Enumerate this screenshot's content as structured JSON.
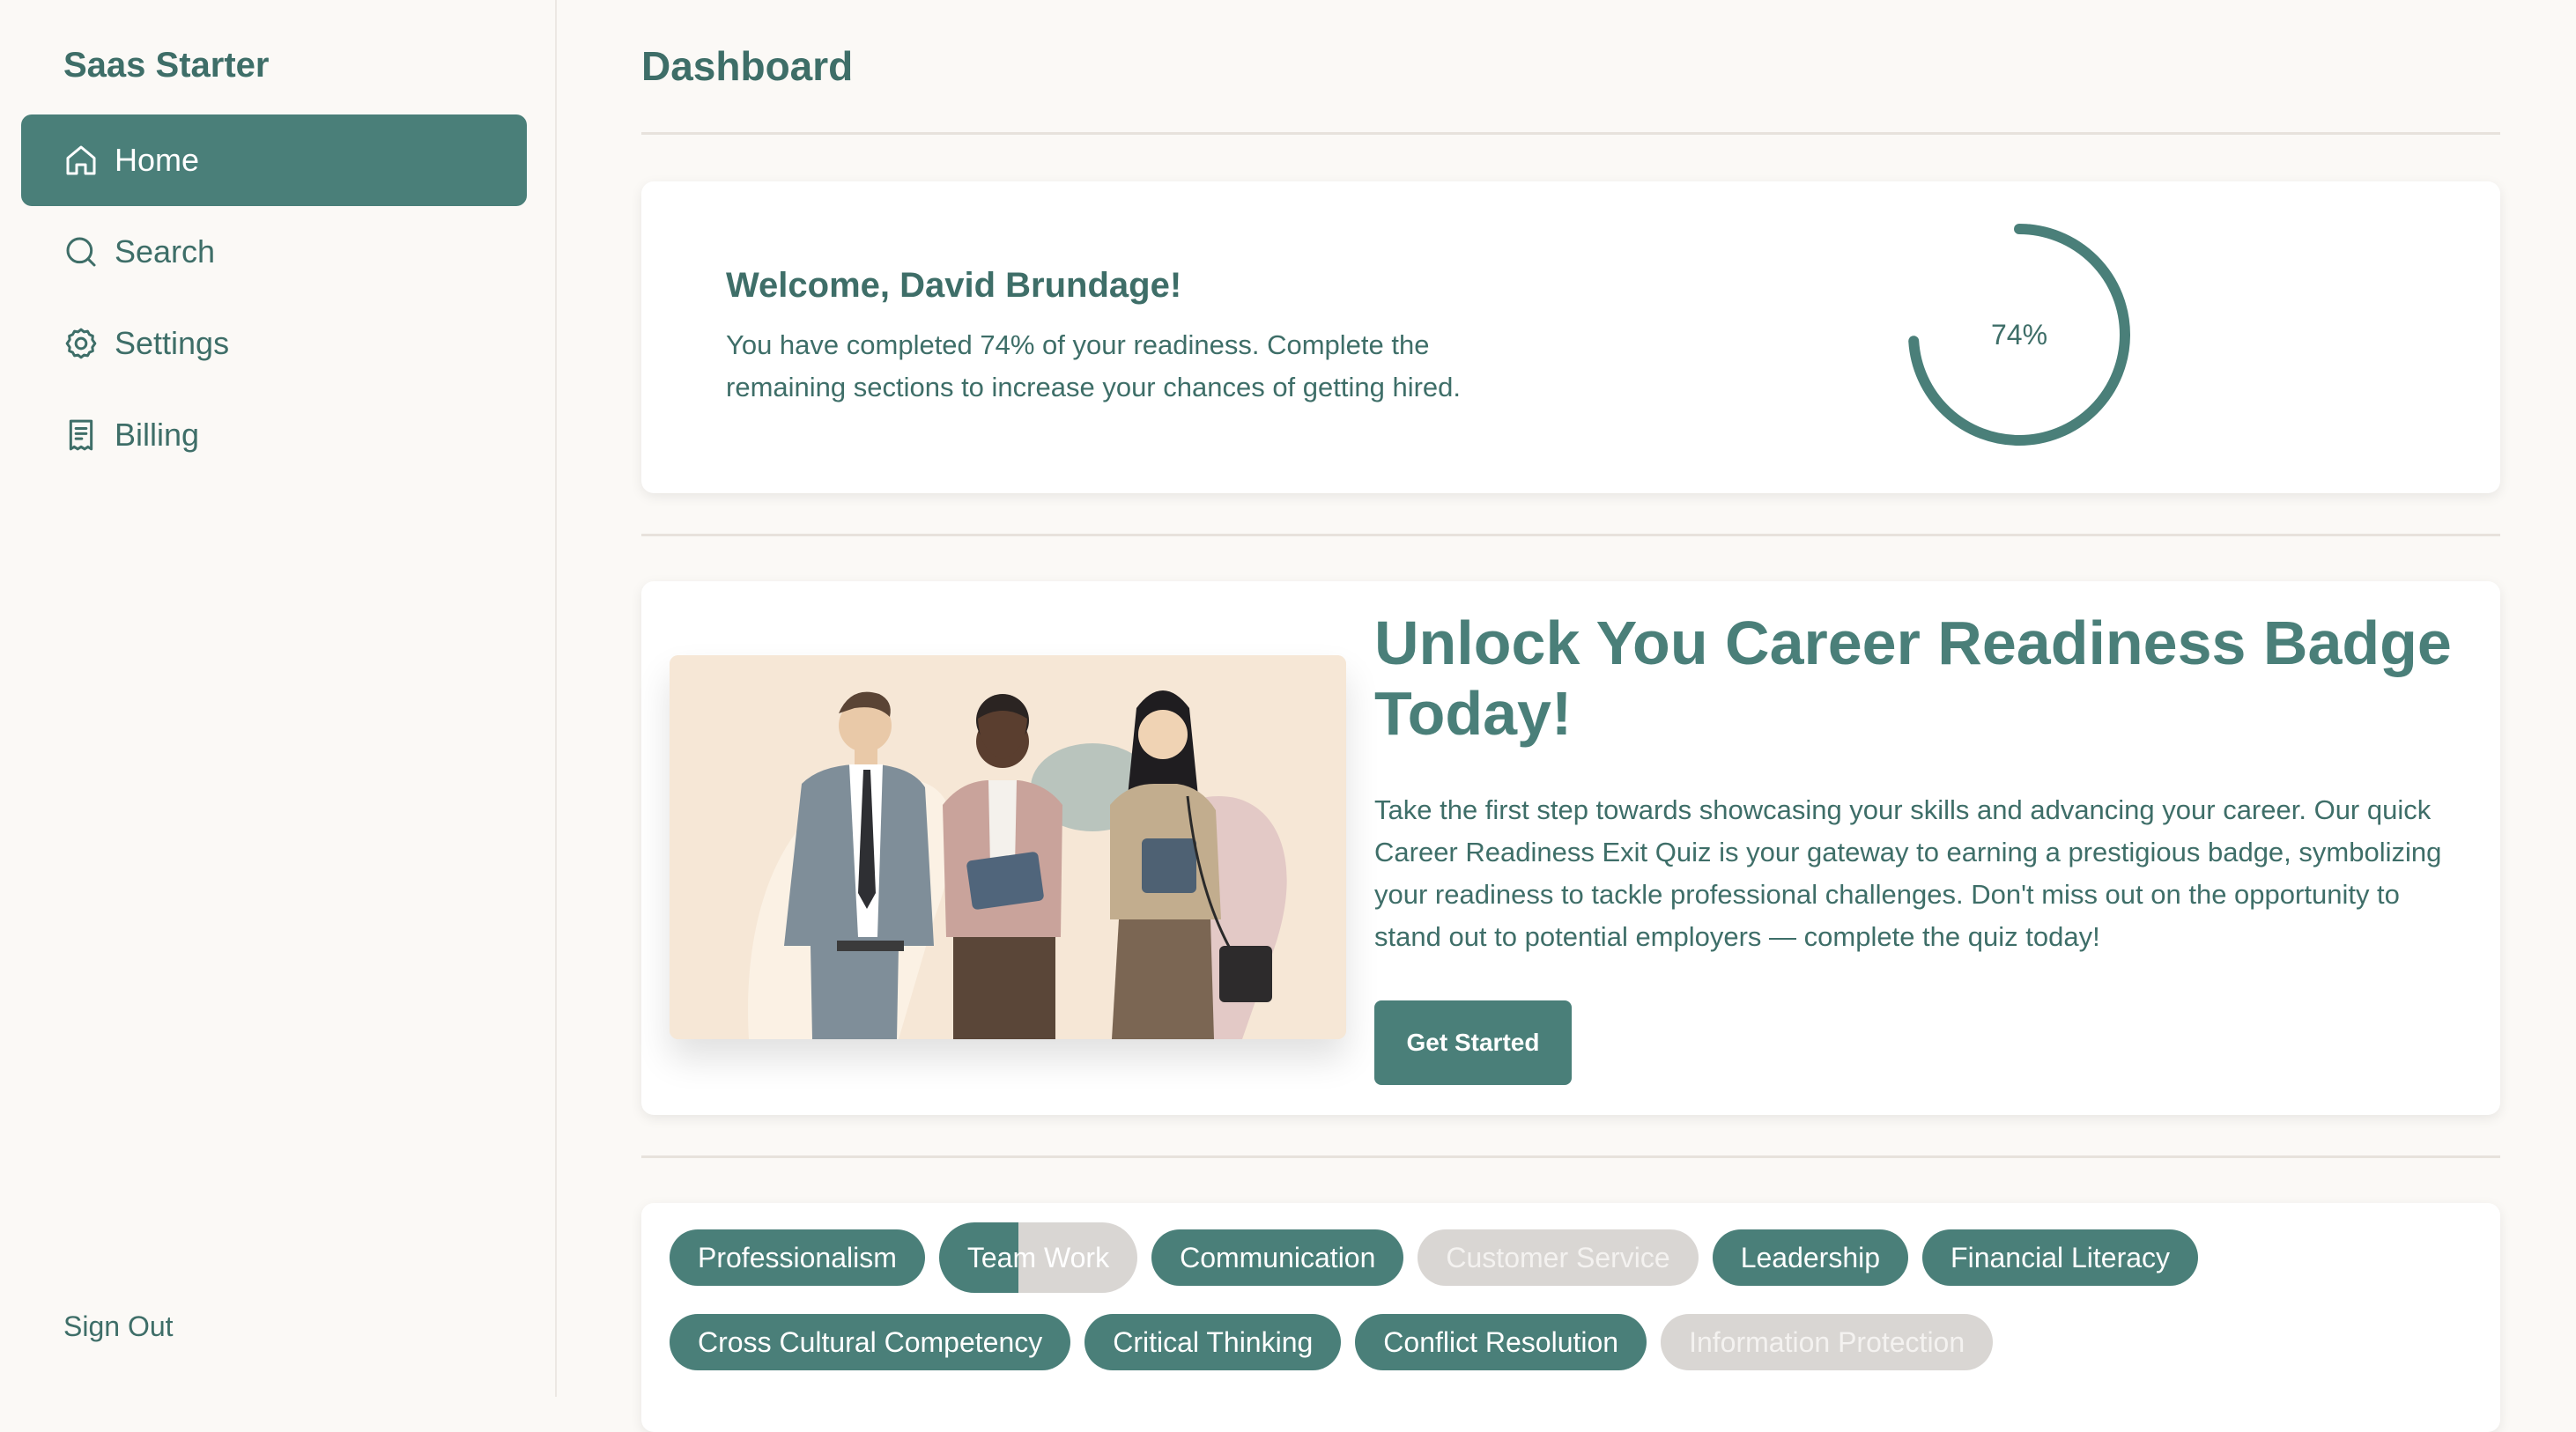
{
  "app": {
    "brand": "Saas Starter"
  },
  "sidebar": {
    "items": [
      {
        "label": "Home",
        "icon": "home-icon",
        "active": true
      },
      {
        "label": "Search",
        "icon": "search-icon",
        "active": false
      },
      {
        "label": "Settings",
        "icon": "settings-icon",
        "active": false
      },
      {
        "label": "Billing",
        "icon": "receipt-icon",
        "active": false
      }
    ],
    "sign_out": "Sign Out"
  },
  "header": {
    "title": "Dashboard"
  },
  "welcome": {
    "title": "Welcome, David Brundage!",
    "text": "You have completed 74% of your readiness. Complete the remaining sections to increase your chances of getting hired.",
    "progress_label": "74%",
    "progress_value": 0.74
  },
  "badge": {
    "title": "Unlock You Career Readiness Badge Today!",
    "text": "Take the first step towards showcasing your skills and advancing your career. Our quick Career Readiness Exit Quiz is your gateway to earning a prestigious badge, symbolizing your readiness to tackle professional challenges. Don't miss out on the opportunity to stand out to potential employers — complete the quiz today!",
    "cta": "Get Started"
  },
  "skills": {
    "row1": [
      {
        "label": "Professionalism",
        "state": "complete"
      },
      {
        "label": "Team Work",
        "state": "partial"
      },
      {
        "label": "Communication",
        "state": "complete"
      },
      {
        "label": "Customer Service",
        "state": "incomplete"
      },
      {
        "label": "Leadership",
        "state": "complete"
      },
      {
        "label": "Financial Literacy",
        "state": "complete"
      }
    ],
    "row2": [
      {
        "label": "Cross Cultural Competency",
        "state": "complete"
      },
      {
        "label": "Critical Thinking",
        "state": "complete"
      },
      {
        "label": "Conflict Resolution",
        "state": "complete"
      },
      {
        "label": "Information Protection",
        "state": "incomplete"
      }
    ]
  },
  "colors": {
    "accent": "#4a7f79",
    "background": "#fbf9f6",
    "pill_incomplete": "#d9d6d3"
  }
}
